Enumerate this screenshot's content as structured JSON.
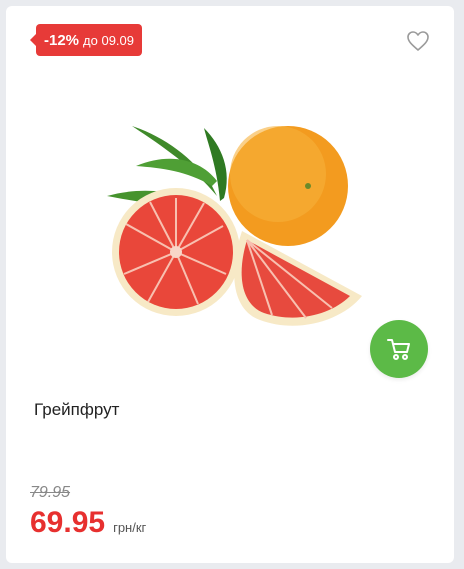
{
  "badge": {
    "discount": "-12%",
    "until": "до 09.09"
  },
  "product": {
    "name": "Грейпфрут",
    "old_price": "79.95",
    "price": "69.95",
    "unit": "грн/кг"
  },
  "icons": {
    "favorite": "heart-icon",
    "cart": "cart-icon"
  },
  "colors": {
    "badge": "#e73a38",
    "price": "#e7302f",
    "cart_button": "#5cba47"
  }
}
